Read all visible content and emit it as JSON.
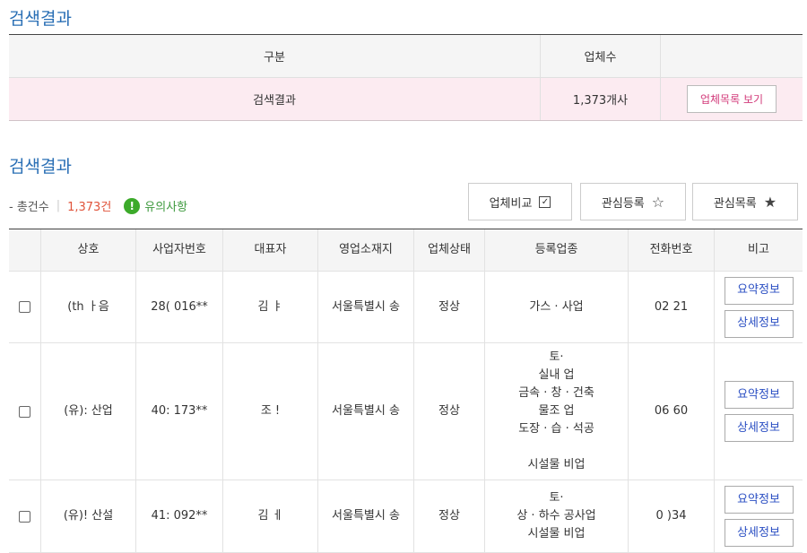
{
  "section1": {
    "title": "검색결과"
  },
  "summary": {
    "headers": [
      "구분",
      "업체수",
      ""
    ],
    "row": {
      "label": "검색결과",
      "count": "1,373개사",
      "button": "업체목록 보기"
    }
  },
  "section2": {
    "title": "검색결과"
  },
  "meta": {
    "total_label": "- 총건수",
    "total_value": "1,373건",
    "notice": "유의사항"
  },
  "toolbar": {
    "compare": "업체비교",
    "add_interest": "관심등록",
    "interest_list": "관심목록"
  },
  "table": {
    "headers": [
      "",
      "상호",
      "사업자번호",
      "대표자",
      "영업소재지",
      "업체상태",
      "등록업종",
      "전화번호",
      "비고"
    ],
    "rows": [
      {
        "name": "(th   ㅏ음",
        "bizno": "28(   016**",
        "rep": "김   ㅑ",
        "loc": "서울특별시 송",
        "status": "정상",
        "types": "가스 ·         사업",
        "phone": "02           21"
      },
      {
        "name": "(유):   산업",
        "bizno": "40:   173**",
        "rep": "조     !",
        "loc": "서울특별시 송",
        "status": "정상",
        "types": "토·\n실내         업\n금속 · 창        · 건축\n물조        업\n도장 · 습        · 석공\n\n시설물        비업",
        "phone": "06           60"
      },
      {
        "name": "(유)!   산설",
        "bizno": "41:   092**",
        "rep": "김   ㅔ",
        "loc": "서울특별시 송",
        "status": "정상",
        "types": "토·\n상 · 하수        공사업\n시설물        비업",
        "phone": "0             )34"
      }
    ],
    "summary_button": "요약정보",
    "detail_button": "상세정보"
  }
}
